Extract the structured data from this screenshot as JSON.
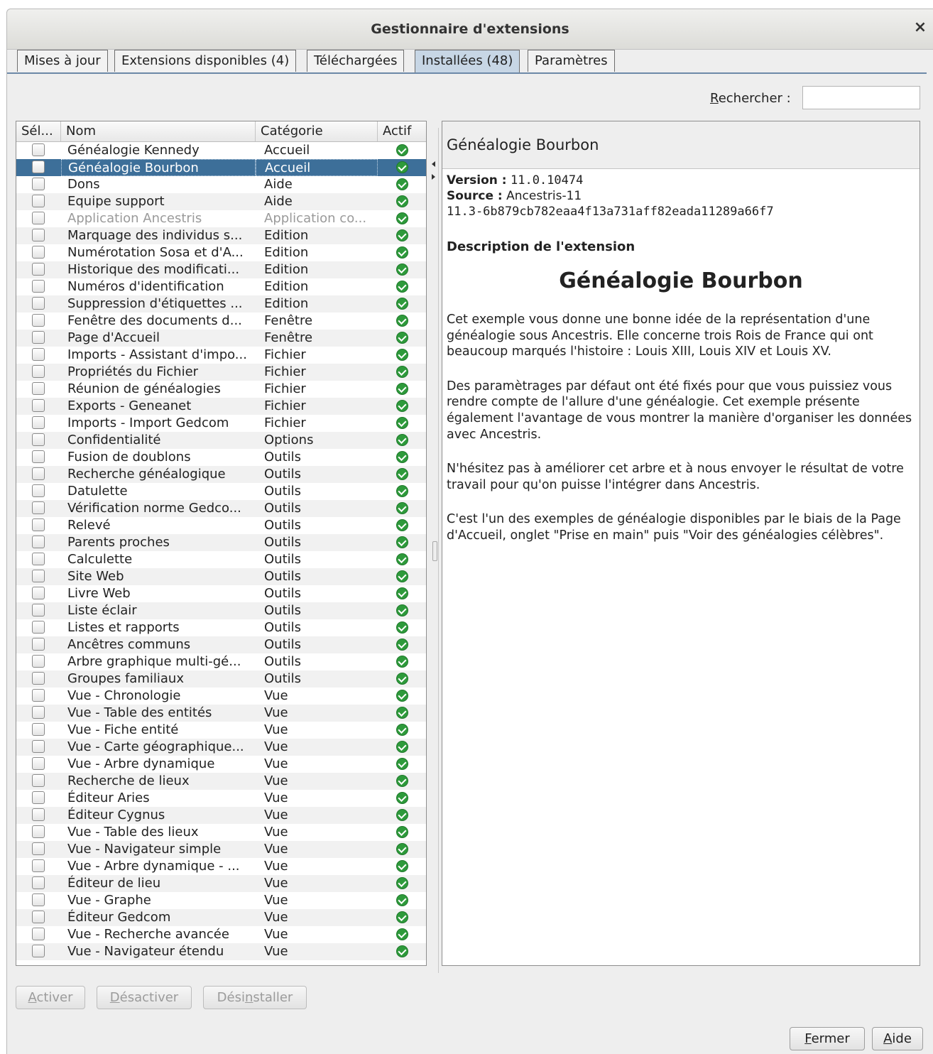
{
  "window": {
    "title": "Gestionnaire d'extensions",
    "close_label": "×"
  },
  "tabs": [
    {
      "label": "Mises à jour"
    },
    {
      "label": "Extensions disponibles (4)"
    },
    {
      "label": "Téléchargées"
    },
    {
      "label": "Installées (48)",
      "active": true
    },
    {
      "label": "Paramètres"
    }
  ],
  "search": {
    "label_pre": "",
    "label_mnemonic": "R",
    "label_post": "echercher :",
    "value": ""
  },
  "table": {
    "columns": [
      "Sél...",
      "Nom",
      "Catégorie",
      "Actif"
    ],
    "selected_index": 1,
    "disabled_index": 4,
    "rows": [
      {
        "name": "Généalogie Kennedy",
        "category": "Accueil"
      },
      {
        "name": "Généalogie Bourbon",
        "category": "Accueil"
      },
      {
        "name": "Dons",
        "category": "Aide"
      },
      {
        "name": "Equipe support",
        "category": "Aide"
      },
      {
        "name": "Application Ancestris",
        "category": "Application co..."
      },
      {
        "name": "Marquage des individus s...",
        "category": "Edition"
      },
      {
        "name": "Numérotation Sosa et d'A...",
        "category": "Edition"
      },
      {
        "name": "Historique des modificati...",
        "category": "Edition"
      },
      {
        "name": "Numéros d'identification",
        "category": "Edition"
      },
      {
        "name": "Suppression d'étiquettes ...",
        "category": "Edition"
      },
      {
        "name": "Fenêtre des documents d...",
        "category": "Fenêtre"
      },
      {
        "name": "Page d'Accueil",
        "category": "Fenêtre"
      },
      {
        "name": "Imports - Assistant d'impo...",
        "category": "Fichier"
      },
      {
        "name": "Propriétés du Fichier",
        "category": "Fichier"
      },
      {
        "name": "Réunion de généalogies",
        "category": "Fichier"
      },
      {
        "name": "Exports - Geneanet",
        "category": "Fichier"
      },
      {
        "name": "Imports - Import Gedcom",
        "category": "Fichier"
      },
      {
        "name": "Confidentialité",
        "category": "Options"
      },
      {
        "name": "Fusion de doublons",
        "category": "Outils"
      },
      {
        "name": "Recherche généalogique",
        "category": "Outils"
      },
      {
        "name": "Datulette",
        "category": "Outils"
      },
      {
        "name": "Vérification norme Gedco...",
        "category": "Outils"
      },
      {
        "name": "Relevé",
        "category": "Outils"
      },
      {
        "name": "Parents proches",
        "category": "Outils"
      },
      {
        "name": "Calculette",
        "category": "Outils"
      },
      {
        "name": "Site Web",
        "category": "Outils"
      },
      {
        "name": "Livre Web",
        "category": "Outils"
      },
      {
        "name": "Liste éclair",
        "category": "Outils"
      },
      {
        "name": "Listes et rapports",
        "category": "Outils"
      },
      {
        "name": "Ancêtres communs",
        "category": "Outils"
      },
      {
        "name": "Arbre graphique multi-gé...",
        "category": "Outils"
      },
      {
        "name": "Groupes familiaux",
        "category": "Outils"
      },
      {
        "name": "Vue - Chronologie",
        "category": "Vue"
      },
      {
        "name": "Vue - Table des entités",
        "category": "Vue"
      },
      {
        "name": "Vue - Fiche entité",
        "category": "Vue"
      },
      {
        "name": "Vue - Carte géographique...",
        "category": "Vue"
      },
      {
        "name": "Vue - Arbre dynamique",
        "category": "Vue"
      },
      {
        "name": "Recherche de lieux",
        "category": "Vue"
      },
      {
        "name": "Éditeur Aries",
        "category": "Vue"
      },
      {
        "name": "Éditeur Cygnus",
        "category": "Vue"
      },
      {
        "name": "Vue - Table des lieux",
        "category": "Vue"
      },
      {
        "name": "Vue - Navigateur simple",
        "category": "Vue"
      },
      {
        "name": "Vue - Arbre dynamique - ...",
        "category": "Vue"
      },
      {
        "name": "Éditeur de lieu",
        "category": "Vue"
      },
      {
        "name": "Vue - Graphe",
        "category": "Vue"
      },
      {
        "name": "Éditeur Gedcom",
        "category": "Vue"
      },
      {
        "name": "Vue - Recherche avancée",
        "category": "Vue"
      },
      {
        "name": "Vue - Navigateur étendu",
        "category": "Vue"
      }
    ],
    "active_icon": "check-circle-icon"
  },
  "detail": {
    "header_title": "Généalogie Bourbon",
    "version_label": "Version :",
    "version_value": "11.0.10474",
    "source_label": "Source :",
    "source_value": "Ancestris-11",
    "source_hash": "11.3-6b879cb782eaa4f13a731aff82eada11289a66f7",
    "description_heading": "Description de l'extension",
    "description_title": "Généalogie Bourbon",
    "paragraphs": [
      "Cet exemple vous donne une bonne idée de la représentation d'une généalogie sous Ancestris. Elle concerne trois Rois de France qui ont beaucoup marqués l'histoire : Louis XIII, Louis XIV et Louis XV.",
      "Des paramètrages par défaut ont été fixés pour que vous puissiez vous rendre compte de l'allure d'une généalogie. Cet exemple présente également l'avantage de vous montrer la manière d'organiser les données avec Ancestris.",
      "N'hésitez pas à améliorer cet arbre et à nous envoyer le résultat de votre travail pour qu'on puisse l'intégrer dans Ancestris.",
      "C'est l'un des exemples de généalogie disponibles par le biais de la Page d'Accueil, onglet \"Prise en main\" puis \"Voir des généalogies célèbres\"."
    ]
  },
  "buttons": {
    "activate": {
      "mn": "A",
      "rest": "ctiver",
      "pre": ""
    },
    "deactivate": {
      "mn": "D",
      "rest": "ésactiver",
      "pre": ""
    },
    "uninstall": {
      "pre": "Dési",
      "mn": "n",
      "rest": "staller"
    },
    "close": {
      "mn": "F",
      "rest": "ermer",
      "pre": ""
    },
    "help": {
      "mn": "A",
      "rest": "ide",
      "pre": ""
    }
  }
}
